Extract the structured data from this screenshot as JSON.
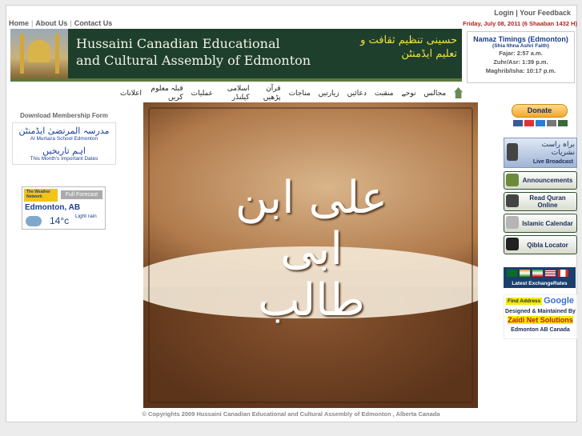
{
  "header": {
    "links_left": [
      "Home",
      "About Us",
      "Contact Us"
    ],
    "links_right": [
      "Login",
      "Your Feedback"
    ],
    "date_line": "Friday, July 08, 2011 (6 Shaaban 1432 H)"
  },
  "banner": {
    "title_line1": "Hussaini Canadian Educational",
    "title_line2": "and Cultural Assembly of Edmonton",
    "title_urdu": "حسینی تنظیم ثقافت و تعلیم ایڈمنٹن"
  },
  "namaz": {
    "title": "Namaz Timings (Edmonton)",
    "subtitle": "(Shia Ithna Ashri Faith)",
    "fajr": "Fajar: 2:57 a.m.",
    "zuhr": "Zuhr/Asr: 1:39 p.m.",
    "maghrib": "Maghrib/Isha: 10:17 p.m."
  },
  "nav": {
    "items": [
      "مجالس",
      "نوحے",
      "منقبت",
      "دعائیں",
      "زیارتیں",
      "مناجات",
      "قرآن پڑھیں",
      "اسلامی کیلنڈر",
      "عملیات",
      "قبلہ معلوم کریں",
      "اعلانات"
    ]
  },
  "left": {
    "download_title": "Download Membership Form",
    "madrasa_urdu": "مدرسہ المرتضیٰ ایڈمنٹن",
    "madrasa_en": "Al Murtaza School Edmonton",
    "dates_urdu": "اہم تاریخیں",
    "dates_en": "This Month's Important Dates"
  },
  "weather": {
    "network": "The Weather Network",
    "forecast_btn": "Full Forecast",
    "city": "Edmonton, AB",
    "temp": "14°c",
    "condition": "Light rain"
  },
  "main_image": {
    "calligraphy": "علی ابن ابی طالب"
  },
  "right": {
    "donate_label": "Donate",
    "live_urdu": "براہ راست نشریات",
    "live_en": "Live Broadcast",
    "announcements": "Announcements",
    "read_quran": "Read Quran Online",
    "islamic_calendar": "Islamic Calendar",
    "qibla": "Qibla Locator",
    "exchange": "Latest ExchangeRates",
    "find_address": "Find Address",
    "google": "Google",
    "designed_by": "Designed & Maintained By",
    "zaidi": "Zaidi Net Solutions",
    "zaidi_city": "Edmonton AB Canada"
  },
  "footer": {
    "copyright": "© Copyrights 2009 Hussaini Canadian Educational and Cultural Assembly of Edmonton , Alberta Canada"
  },
  "colors": {
    "banner_bg": "#1f3f2d",
    "link_blue": "#1b3f8a",
    "date_red": "#b22222"
  }
}
